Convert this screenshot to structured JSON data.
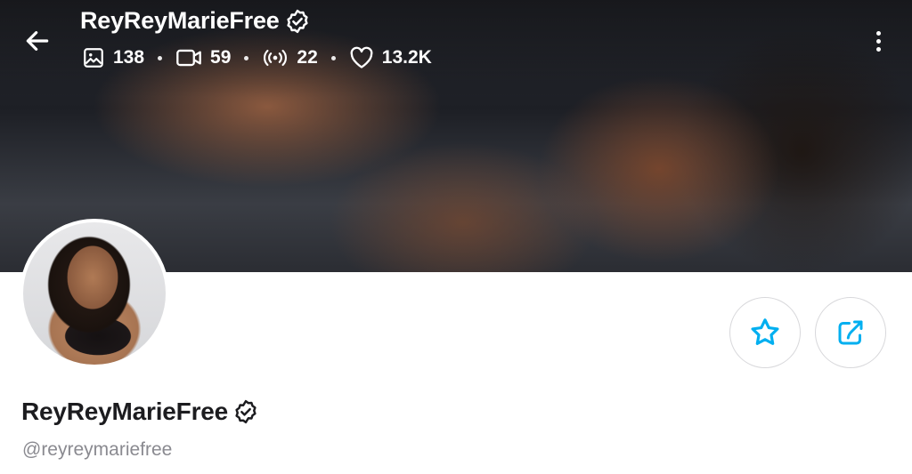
{
  "header": {
    "title": "ReyReyMarieFree",
    "stats": {
      "photos": "138",
      "videos": "59",
      "streams": "22",
      "likes": "13.2K"
    }
  },
  "profile": {
    "display_name": "ReyReyMarieFree",
    "username": "@reyreymariefree"
  },
  "colors": {
    "accent": "#00aff0",
    "text_dark": "#1c1c1f",
    "text_muted": "#8a8a90",
    "button_border": "#d8d8db"
  },
  "icons": {
    "back": "arrow-left-icon",
    "verified": "verified-badge-icon",
    "photos": "image-icon",
    "videos": "video-icon",
    "streams": "broadcast-icon",
    "likes": "heart-icon",
    "more": "more-vertical-icon",
    "favorite": "star-icon",
    "share": "share-icon"
  }
}
